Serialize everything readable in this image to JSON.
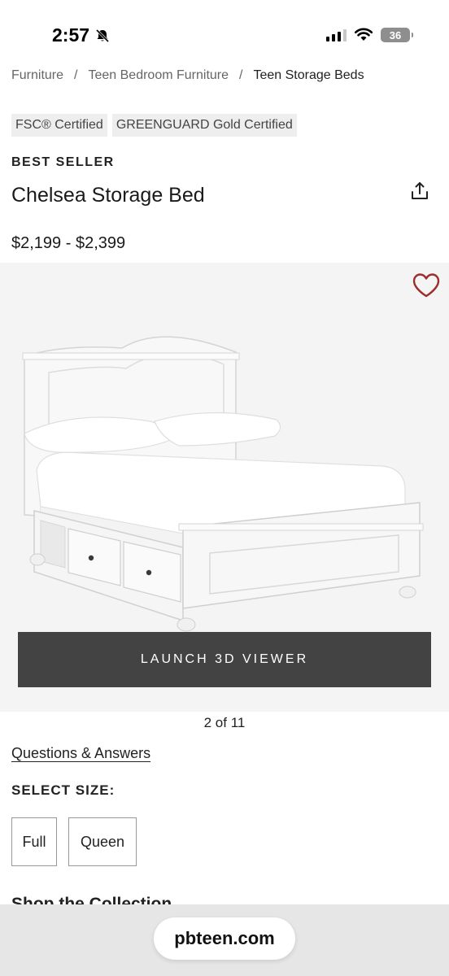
{
  "status": {
    "time": "2:57",
    "battery": "36"
  },
  "breadcrumb": {
    "items": [
      {
        "label": "Furniture"
      },
      {
        "label": "Teen Bedroom Furniture"
      },
      {
        "label": "Teen Storage Beds"
      }
    ],
    "separator": "/"
  },
  "certs": [
    "FSC® Certified",
    "GREENGUARD Gold Certified"
  ],
  "product": {
    "badge": "BEST SELLER",
    "title": "Chelsea Storage Bed",
    "price": "$2,199 - $2,399"
  },
  "gallery": {
    "launch_label": "LAUNCH 3D VIEWER",
    "counter": "2 of 11"
  },
  "qa_link": "Questions & Answers",
  "size": {
    "heading": "SELECT SIZE:",
    "options": [
      "Full",
      "Queen"
    ]
  },
  "collection_heading": "Shop the Collection",
  "browser": {
    "url": "pbteen.com"
  },
  "colors": {
    "button_bg": "#434343",
    "heart": "#9b2d2d",
    "image_bg": "#f4f4f4"
  }
}
